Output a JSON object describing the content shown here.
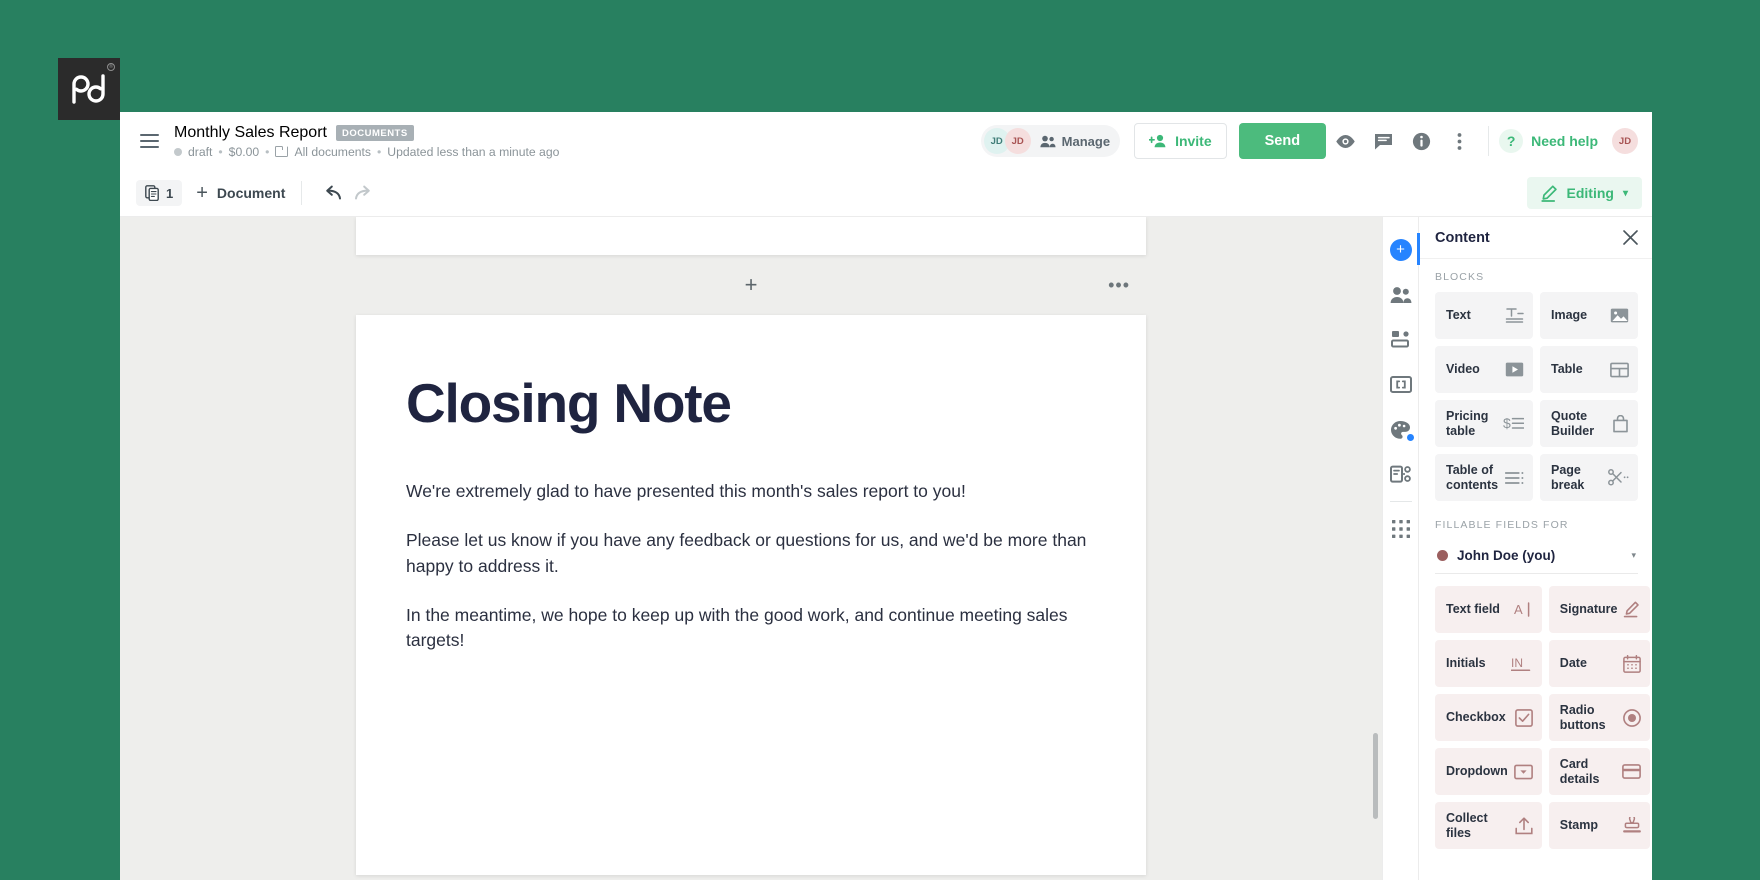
{
  "brand": {
    "logo_text": "pd",
    "registered_mark": "®"
  },
  "header": {
    "menu_icon": "hamburger-icon",
    "title": "Monthly Sales Report",
    "badge": "DOCUMENTS",
    "status": "draft",
    "amount": "$0.00",
    "folder": "All documents",
    "updated": "Updated less than a minute ago",
    "separator": "•",
    "collaborators": [
      {
        "initials": "JD"
      },
      {
        "initials": "JD"
      }
    ],
    "manage_label": "Manage",
    "invite_label": "Invite",
    "send_label": "Send",
    "icons": [
      "eye-icon",
      "comment-icon",
      "info-icon",
      "more-vertical-icon"
    ],
    "need_help_label": "Need help",
    "need_help_mark": "?",
    "account_initials": "JD"
  },
  "toolbar": {
    "page_count": "1",
    "page_count_icon": "pages-icon",
    "add_document_label": "Document",
    "add_icon": "plus-icon",
    "undo_icon": "undo-icon",
    "redo_icon": "redo-icon",
    "mode_label": "Editing",
    "mode_icon": "pencil-icon",
    "mode_caret": "▾"
  },
  "canvas": {
    "insert_block_icon": "plus-icon",
    "page_options_icon": "more-horizontal-icon",
    "document": {
      "heading": "Closing Note",
      "paragraphs": [
        "We're extremely glad to have presented this month's sales report to you!",
        "Please let us know if you have any feedback or questions for us, and we'd be more than happy to address it.",
        "In the meantime, we hope to keep up with the good work, and continue meeting sales targets!"
      ]
    }
  },
  "rail": {
    "items": [
      {
        "name": "add-content-icon",
        "active": true
      },
      {
        "name": "recipients-icon",
        "active": false
      },
      {
        "name": "layout-icon",
        "active": false
      },
      {
        "name": "variables-icon",
        "active": false
      },
      {
        "name": "theme-icon",
        "active": false
      },
      {
        "name": "workflow-icon",
        "active": false
      },
      {
        "name": "apps-grid-icon",
        "active": false
      }
    ]
  },
  "panel": {
    "title": "Content",
    "close_icon": "close-icon",
    "blocks_label": "BLOCKS",
    "blocks": [
      {
        "label": "Text",
        "icon": "text-block-icon"
      },
      {
        "label": "Image",
        "icon": "image-icon"
      },
      {
        "label": "Video",
        "icon": "video-icon"
      },
      {
        "label": "Table",
        "icon": "table-icon"
      },
      {
        "label": "Pricing table",
        "icon": "pricing-table-icon"
      },
      {
        "label": "Quote Builder",
        "icon": "quote-builder-icon"
      },
      {
        "label": "Table of contents",
        "icon": "table-of-contents-icon"
      },
      {
        "label": "Page break",
        "icon": "page-break-icon"
      }
    ],
    "fillable_label": "FILLABLE FIELDS FOR",
    "signer": {
      "name": "John Doe (you)",
      "color": "#9b5f5f",
      "caret": "▾"
    },
    "fields": [
      {
        "label": "Text field",
        "icon": "text-field-icon"
      },
      {
        "label": "Signature",
        "icon": "signature-icon"
      },
      {
        "label": "Initials",
        "icon": "initials-icon"
      },
      {
        "label": "Date",
        "icon": "calendar-icon"
      },
      {
        "label": "Checkbox",
        "icon": "checkbox-icon"
      },
      {
        "label": "Radio buttons",
        "icon": "radio-button-icon"
      },
      {
        "label": "Dropdown",
        "icon": "dropdown-icon"
      },
      {
        "label": "Card details",
        "icon": "credit-card-icon"
      },
      {
        "label": "Collect files",
        "icon": "upload-icon"
      },
      {
        "label": "Stamp",
        "icon": "stamp-icon"
      }
    ]
  },
  "colors": {
    "background": "#288060",
    "accent_green": "#3cb878",
    "send_green": "#4cbb7d",
    "accent_blue": "#2684ff",
    "signer_red": "#9b5f5f",
    "text_dark": "#1f2440"
  }
}
